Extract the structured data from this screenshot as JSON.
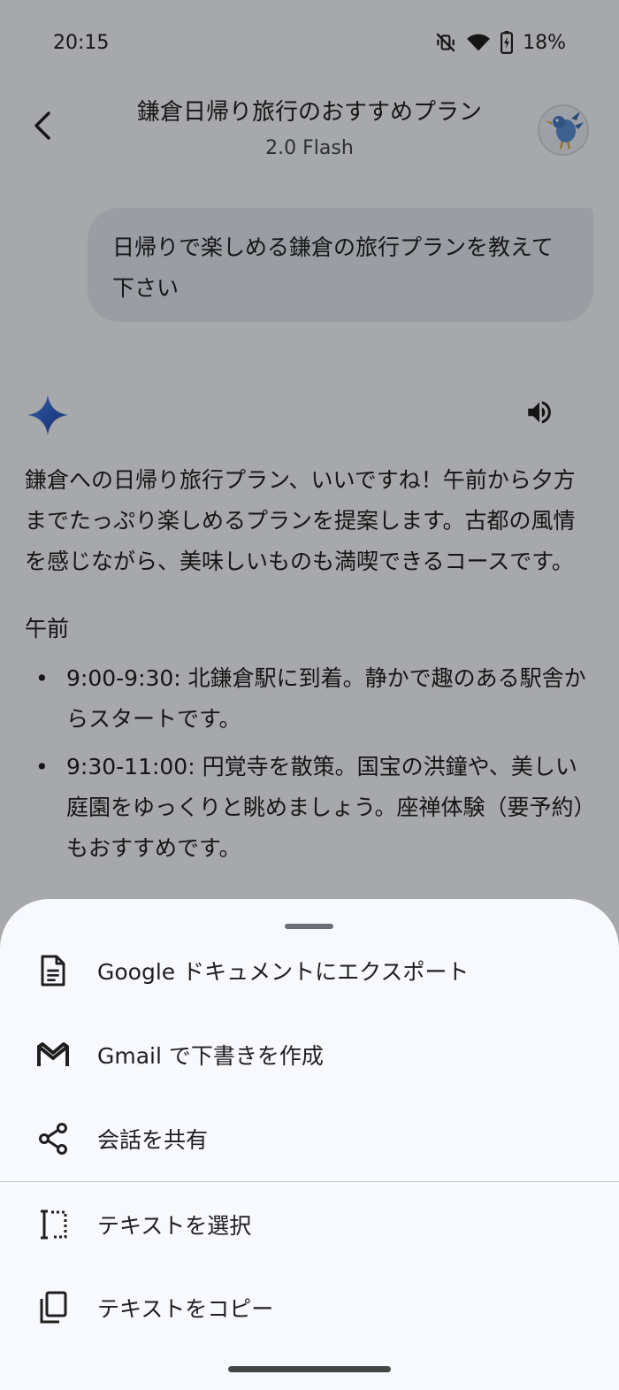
{
  "status_bar": {
    "time": "20:15",
    "battery_percent": "18%",
    "icons": [
      "vibrate-off-icon",
      "wifi-icon",
      "battery-charging-icon"
    ]
  },
  "header": {
    "title": "鎌倉日帰り旅行のおすすめプラン",
    "model": "2.0 Flash",
    "back_icon": "back-arrow-icon",
    "avatar_icon": "bird-avatar-icon"
  },
  "conversation": {
    "user_message": "日帰りで楽しめる鎌倉の旅行プランを教えて下さい",
    "response": {
      "intro": "鎌倉への日帰り旅行プラン、いいですね！午前から夕方までたっぷり楽しめるプランを提案します。古都の風情を感じながら、美味しいものも満喫できるコースです。",
      "section_heading": "午前",
      "bullets": [
        "9:00-9:30: 北鎌倉駅に到着。静かで趣のある駅舎からスタートです。",
        "9:30-11:00: 円覚寺を散策。国宝の洪鐘や、美しい庭園をゆっくりと眺めましょう。座禅体験（要予約）もおすすめです。"
      ],
      "bullet_char": "•"
    }
  },
  "sheet": {
    "items": [
      {
        "label": "Google ドキュメントにエクスポート",
        "icon": "document-icon"
      },
      {
        "label": "Gmail で下書きを作成",
        "icon": "gmail-icon"
      },
      {
        "label": "会話を共有",
        "icon": "share-icon"
      },
      {
        "label": "テキストを選択",
        "icon": "select-text-icon"
      },
      {
        "label": "テキストをコピー",
        "icon": "copy-icon"
      }
    ]
  },
  "colors": {
    "scrim": "rgba(0,0,0,0.32)",
    "sheet_background": "#f8f9fe",
    "user_bubble": "#e3e8f2",
    "gemini_spark_start": "#4285f4",
    "gemini_spark_end": "#1a3fa8"
  }
}
